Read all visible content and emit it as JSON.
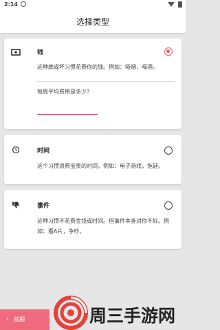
{
  "status_bar": {
    "time": "2:14"
  },
  "app_bar": {
    "title": "选择类型"
  },
  "options": {
    "money": {
      "title": "钱",
      "description": "这种廊或坏习惯花费你的钱。例如：吸烟，喝酒。",
      "icon": "money-icon",
      "selected": true,
      "question": "每周平均费用是多少?",
      "input_value": ""
    },
    "time": {
      "title": "时间",
      "description": "这个习惯浪费宝贵的时间。例如：电子游戏，拖延。",
      "icon": "clock-icon",
      "selected": false
    },
    "event": {
      "title": "事件",
      "description": "这种习惯不花费金钱或时间。但事件本身对你不好。例如：看A片，争吵。",
      "icon": "thumbs-down-icon",
      "selected": false
    }
  },
  "footer": {
    "back_label": "前期",
    "back_arrow": "‹",
    "brand_text": "周三手游网"
  },
  "colors": {
    "accent": "#e55a72",
    "back_button": "#f06a7e",
    "background": "#e6e6e6"
  }
}
